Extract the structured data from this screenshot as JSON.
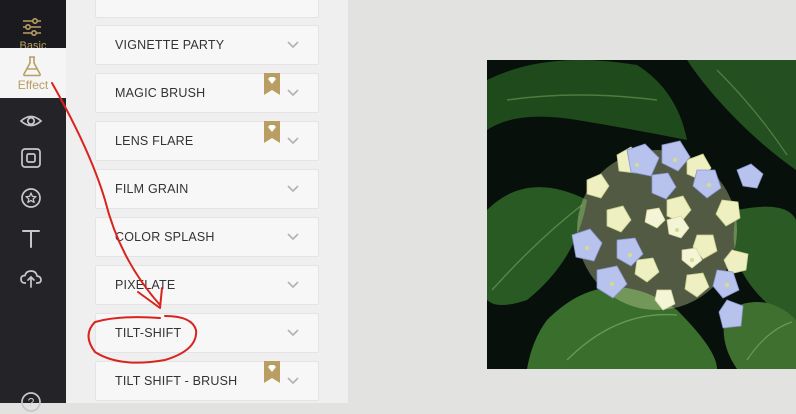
{
  "sidebar": {
    "tabs": [
      {
        "label": "Basic",
        "icon": "sliders-icon"
      },
      {
        "label": "Effect",
        "icon": "flask-icon"
      }
    ],
    "icons": [
      "eye-icon",
      "frame-icon",
      "sticker-icon",
      "text-icon",
      "cloud-upload-icon",
      "help-icon"
    ],
    "accent_color": "#b89e63"
  },
  "effects": [
    {
      "label": "VIGNETTE PARTY",
      "premium": false
    },
    {
      "label": "MAGIC BRUSH",
      "premium": true
    },
    {
      "label": "LENS FLARE",
      "premium": true
    },
    {
      "label": "FILM GRAIN",
      "premium": false
    },
    {
      "label": "COLOR SPLASH",
      "premium": false
    },
    {
      "label": "PIXELATE",
      "premium": false
    },
    {
      "label": "TILT-SHIFT",
      "premium": false
    },
    {
      "label": "TILT SHIFT - BRUSH",
      "premium": true
    }
  ],
  "canvas": {
    "subject": "hydrangea flower photo"
  }
}
